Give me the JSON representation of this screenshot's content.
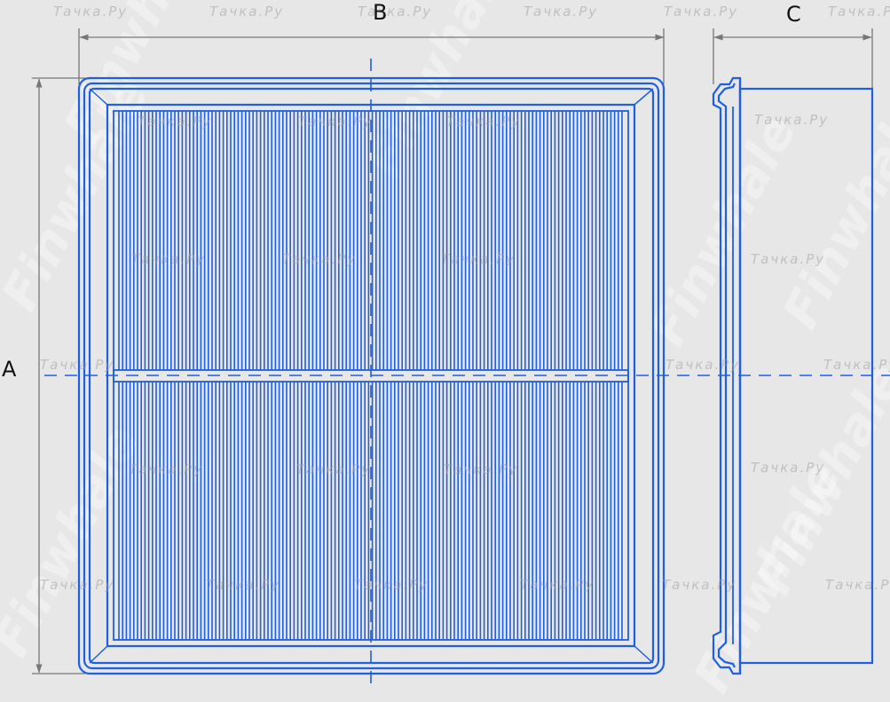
{
  "labels": {
    "dim_a": "A",
    "dim_b": "B",
    "dim_c": "C"
  },
  "watermark": {
    "text": "Тачка.Ру",
    "brand": "Finwhale"
  },
  "colors": {
    "line": "#1f5fe0",
    "dimension": "#777777",
    "background": "#e7e7e7"
  }
}
